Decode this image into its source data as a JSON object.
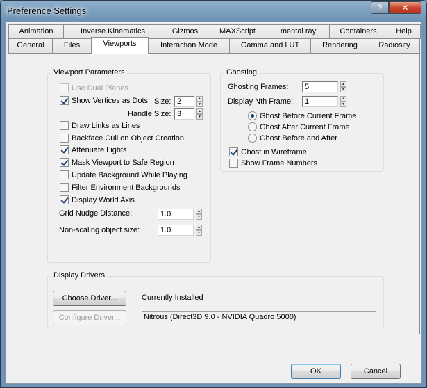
{
  "window": {
    "title": "Preference Settings",
    "help_label": "?",
    "close_label": "✕"
  },
  "tabs_row1": [
    "Animation",
    "Inverse Kinematics",
    "Gizmos",
    "MAXScript",
    "mental ray",
    "Containers",
    "Help"
  ],
  "tabs_row2": [
    "General",
    "Files",
    "Viewports",
    "Interaction Mode",
    "Gamma and LUT",
    "Rendering",
    "Radiosity"
  ],
  "active_tab": "Viewports",
  "viewport_parameters": {
    "title": "Viewport Parameters",
    "use_dual_planes": {
      "label": "Use Dual Planes",
      "checked": false,
      "enabled": false
    },
    "show_vertices_as_dots": {
      "label": "Show Vertices as Dots",
      "checked": true
    },
    "size_label": "Size:",
    "size_value": "2",
    "handle_size_label": "Handle Size:",
    "handle_size_value": "3",
    "draw_links_as_lines": {
      "label": "Draw Links as Lines",
      "checked": false
    },
    "backface_cull": {
      "label": "Backface Cull on Object Creation",
      "checked": false
    },
    "attenuate_lights": {
      "label": "Attenuate Lights",
      "checked": true
    },
    "mask_viewport": {
      "label": "Mask Viewport to Safe Region",
      "checked": true
    },
    "update_background": {
      "label": "Update Background While Playing",
      "checked": false
    },
    "filter_env_backgrounds": {
      "label": "Filter Environment Backgrounds",
      "checked": false
    },
    "display_world_axis": {
      "label": "Display World Axis",
      "checked": true
    },
    "grid_nudge_label": "Grid Nudge Distance:",
    "grid_nudge_value": "1.0",
    "non_scaling_label": "Non-scaling object size:",
    "non_scaling_value": "1.0"
  },
  "ghosting": {
    "title": "Ghosting",
    "frames_label": "Ghosting Frames:",
    "frames_value": "5",
    "nth_label": "Display Nth Frame:",
    "nth_value": "1",
    "radio_before": "Ghost Before Current Frame",
    "radio_after": "Ghost After Current Frame",
    "radio_both": "Ghost Before and After",
    "selected_radio": "before",
    "ghost_in_wireframe": {
      "label": "Ghost in Wireframe",
      "checked": true
    },
    "show_frame_numbers": {
      "label": "Show Frame Numbers",
      "checked": false
    }
  },
  "display_drivers": {
    "title": "Display Drivers",
    "choose_driver_label": "Choose Driver...",
    "currently_installed_label": "Currently Installed",
    "configure_driver_label": "Configure Driver...",
    "driver_value": "Nitrous (Direct3D 9.0 - NVIDIA Quadro 5000)"
  },
  "footer": {
    "ok_label": "OK",
    "cancel_label": "Cancel"
  },
  "spinner_up": "▲",
  "spinner_down": "▼"
}
